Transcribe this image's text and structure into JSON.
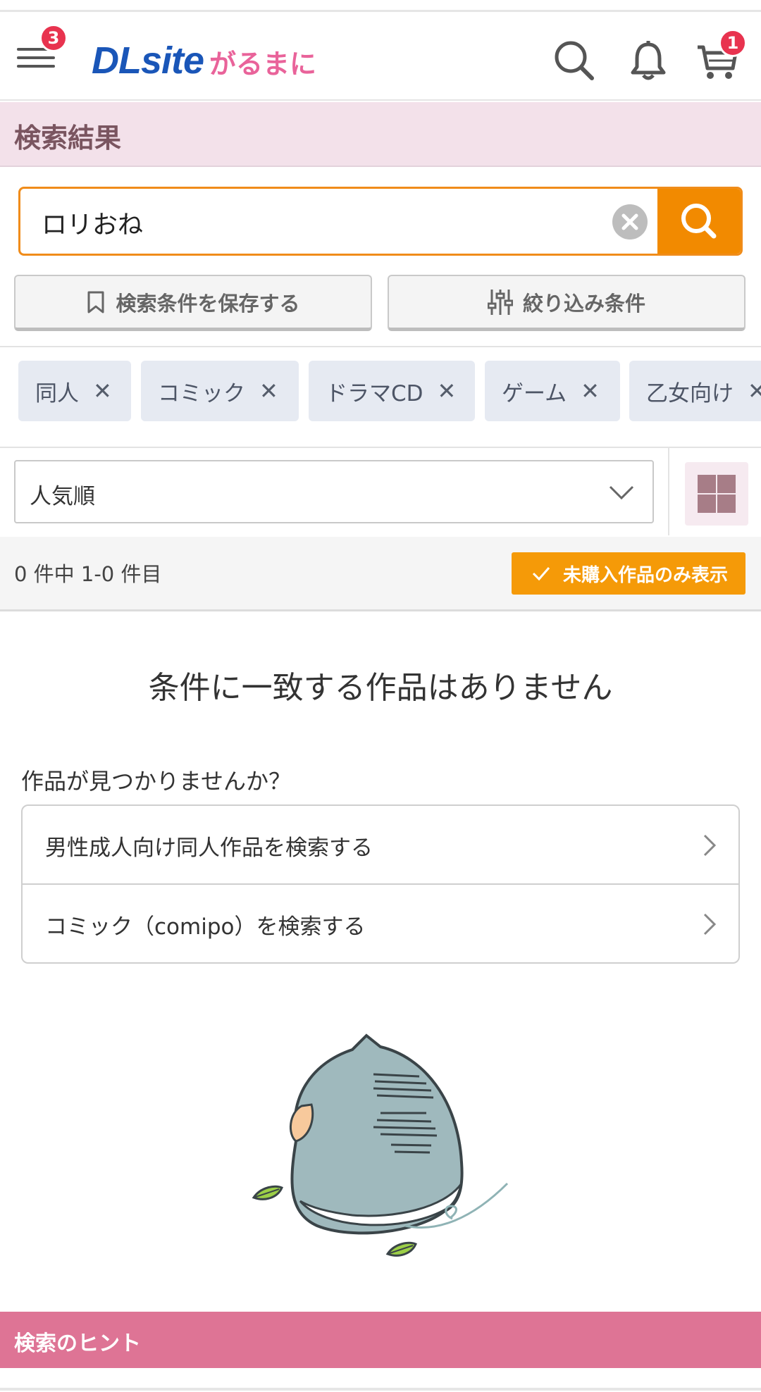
{
  "header": {
    "menu_badge": "3",
    "logo_main": "DLsite",
    "logo_sub": "がるまに",
    "cart_badge": "1"
  },
  "page_title": "検索結果",
  "search": {
    "query": "ロリおね"
  },
  "actions": {
    "save_condition": "検索条件を保存する",
    "refine": "絞り込み条件"
  },
  "chips": [
    {
      "label": "同人",
      "remove": "✕"
    },
    {
      "label": "コミック",
      "remove": "✕"
    },
    {
      "label": "ドラマCD",
      "remove": "✕"
    },
    {
      "label": "ゲーム",
      "remove": "✕"
    },
    {
      "label": "乙女向け",
      "remove": "✕"
    }
  ],
  "sort": {
    "selected": "人気順"
  },
  "results": {
    "count_text": "0 件中 1-0 件目",
    "unpurchased_only": "未購入作品のみ表示",
    "no_results": "条件に一致する作品はありません",
    "not_found_question": "作品が見つかりませんか？"
  },
  "suggest_links": [
    {
      "label": "男性成人向け同人作品を検索する"
    },
    {
      "label": "コミック（comipo）を検索する"
    }
  ],
  "hint_section": {
    "title": "検索のヒント"
  },
  "colors": {
    "accent_orange": "#f28a00",
    "brand_blue": "#1a56b8",
    "brand_pink": "#e9639a",
    "badge_red": "#e8334f",
    "title_bar_pink": "#f3e1ea",
    "hint_bar_pink": "#de7495"
  }
}
